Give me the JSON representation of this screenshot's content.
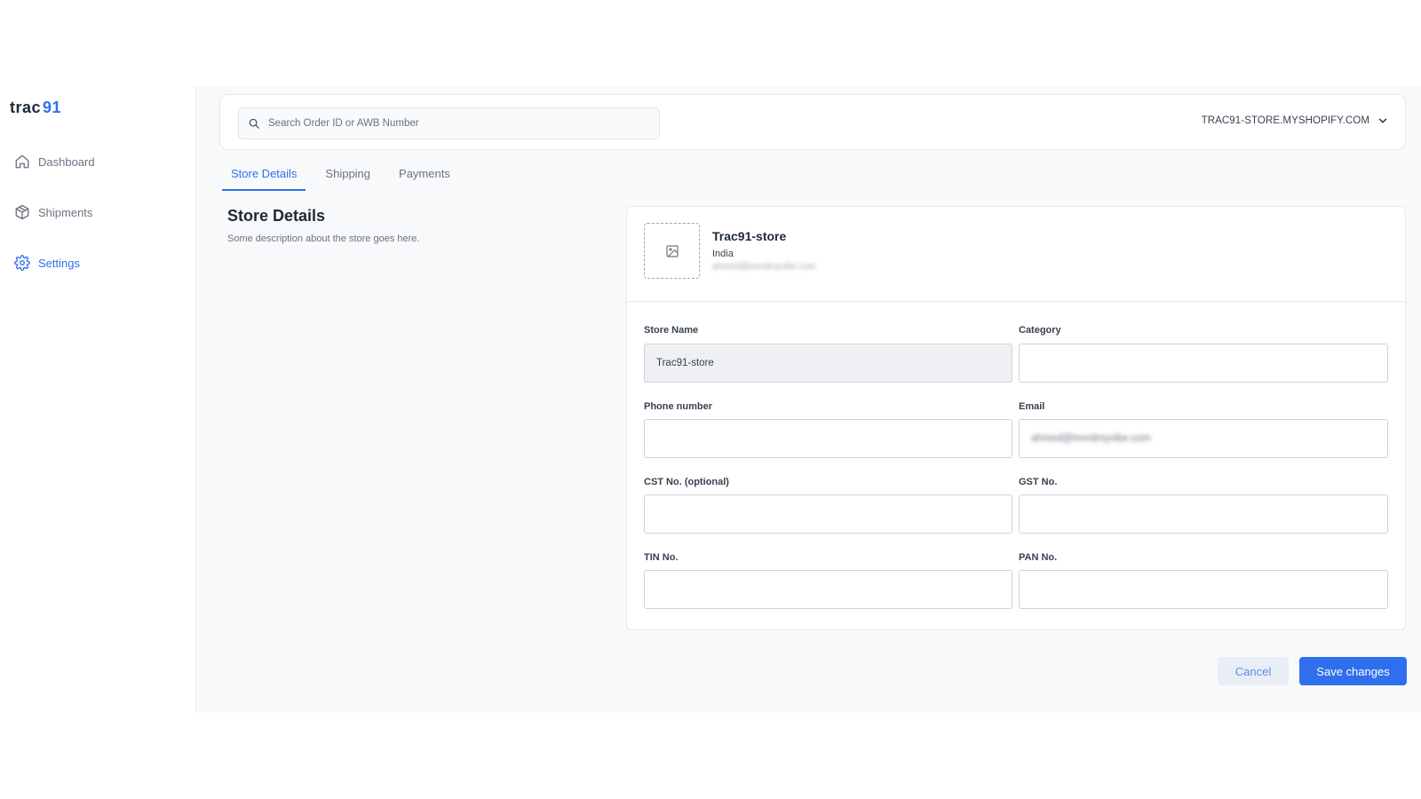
{
  "brand": {
    "logo_part_a": "trac",
    "logo_part_b": "91",
    "accent": "#2f6fed"
  },
  "sidebar": {
    "items": [
      {
        "label": "Dashboard",
        "icon": "home-icon",
        "active": false
      },
      {
        "label": "Shipments",
        "icon": "package-icon",
        "active": false
      },
      {
        "label": "Settings",
        "icon": "gear-icon",
        "active": true
      }
    ]
  },
  "topbar": {
    "search_placeholder": "Search Order ID or AWB Number",
    "store_selector": "TRAC91-STORE.MYSHOPIFY.COM"
  },
  "tabs": [
    {
      "label": "Store Details",
      "active": true
    },
    {
      "label": "Shipping",
      "active": false
    },
    {
      "label": "Payments",
      "active": false
    }
  ],
  "section": {
    "title": "Store Details",
    "description": "Some description about the store goes here."
  },
  "store_card": {
    "name": "Trac91-store",
    "country": "India",
    "email": "ahmed@trendmyvibe.com"
  },
  "form": {
    "store_name": {
      "label": "Store Name",
      "value": "Trac91-store"
    },
    "category": {
      "label": "Category",
      "value": ""
    },
    "phone": {
      "label": "Phone number",
      "value": ""
    },
    "email": {
      "label": "Email",
      "value": "ahmed@trendmyvibe.com"
    },
    "cst": {
      "label": "CST No. (optional)",
      "value": ""
    },
    "gst": {
      "label": "GST No.",
      "value": ""
    },
    "tin": {
      "label": "TIN No.",
      "value": ""
    },
    "pan": {
      "label": "PAN No.",
      "value": ""
    }
  },
  "actions": {
    "cancel": "Cancel",
    "save": "Save changes"
  }
}
